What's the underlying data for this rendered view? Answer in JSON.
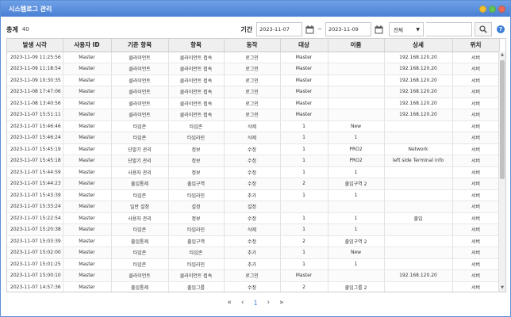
{
  "window": {
    "title": "시스템로그 관리"
  },
  "toolbar": {
    "total_label": "총계",
    "total_count": "40",
    "period_label": "기간",
    "date_from": "2023-11-07",
    "date_to": "2023-11-09",
    "tilde": "~",
    "filter_selected": "전체",
    "search_value": "",
    "help_glyph": "?"
  },
  "table": {
    "columns": [
      "발생 시각",
      "사용자 ID",
      "기준 항목",
      "항목",
      "동작",
      "대상",
      "이름",
      "상세",
      "위치"
    ],
    "rows": [
      [
        "2023-11-09 11:25:56",
        "Master",
        "클라이언트",
        "클라이언트 접속",
        "로그인",
        "Master",
        "",
        "192.168.120.20",
        "서버"
      ],
      [
        "2023-11-09 11:18:54",
        "Master",
        "클라이언트",
        "클라이언트 접속",
        "로그인",
        "Master",
        "",
        "192.168.120.20",
        "서버"
      ],
      [
        "2023-11-09 10:30:35",
        "Master",
        "클라이언트",
        "클라이언트 접속",
        "로그인",
        "Master",
        "",
        "192.168.120.20",
        "서버"
      ],
      [
        "2023-11-08 17:47:06",
        "Master",
        "클라이언트",
        "클라이언트 접속",
        "로그인",
        "Master",
        "",
        "192.168.120.20",
        "서버"
      ],
      [
        "2023-11-08 13:40:56",
        "Master",
        "클라이언트",
        "클라이언트 접속",
        "로그인",
        "Master",
        "",
        "192.168.120.20",
        "서버"
      ],
      [
        "2023-11-07 15:51:11",
        "Master",
        "클라이언트",
        "클라이언트 접속",
        "로그인",
        "Master",
        "",
        "192.168.120.20",
        "서버"
      ],
      [
        "2023-11-07 15:46:46",
        "Master",
        "타임존",
        "타임존",
        "삭제",
        "1",
        "New",
        "",
        "서버"
      ],
      [
        "2023-11-07 15:46:24",
        "Master",
        "타임존",
        "타임라인",
        "삭제",
        "1",
        "1",
        "",
        "서버"
      ],
      [
        "2023-11-07 15:45:19",
        "Master",
        "단말기 관리",
        "정보",
        "수정",
        "1",
        "PRO2",
        "Network",
        "서버"
      ],
      [
        "2023-11-07 15:45:18",
        "Master",
        "단말기 관리",
        "정보",
        "수정",
        "1",
        "PRO2",
        "left side Terminal info",
        "서버"
      ],
      [
        "2023-11-07 15:44:59",
        "Master",
        "사용자 관리",
        "정보",
        "수정",
        "1",
        "1",
        "",
        "서버"
      ],
      [
        "2023-11-07 15:44:23",
        "Master",
        "출입통제",
        "출입구역",
        "수정",
        "2",
        "출입구역 2",
        "",
        "서버"
      ],
      [
        "2023-11-07 15:43:39",
        "Master",
        "타임존",
        "타임라인",
        "추가",
        "1",
        "1",
        "",
        "서버"
      ],
      [
        "2023-11-07 15:33:24",
        "Master",
        "일반 설정",
        "설정",
        "설정",
        "",
        "",
        "",
        "서버"
      ],
      [
        "2023-11-07 15:22:54",
        "Master",
        "사용자 관리",
        "정보",
        "수정",
        "1",
        "1",
        "출입",
        "서버"
      ],
      [
        "2023-11-07 15:20:38",
        "Master",
        "타임존",
        "타임라인",
        "삭제",
        "1",
        "1",
        "",
        "서버"
      ],
      [
        "2023-11-07 15:03:39",
        "Master",
        "출입통제",
        "출입구역",
        "수정",
        "2",
        "출입구역 2",
        "",
        "서버"
      ],
      [
        "2023-11-07 15:02:00",
        "Master",
        "타임존",
        "타임존",
        "추가",
        "1",
        "New",
        "",
        "서버"
      ],
      [
        "2023-11-07 15:01:25",
        "Master",
        "타임존",
        "타임라인",
        "추가",
        "1",
        "1",
        "",
        "서버"
      ],
      [
        "2023-11-07 15:00:10",
        "Master",
        "클라이언트",
        "클라이언트 접속",
        "로그인",
        "Master",
        "",
        "192.168.120.20",
        "서버"
      ],
      [
        "2023-11-07 14:57:36",
        "Master",
        "출입통제",
        "출입그룹",
        "수정",
        "2",
        "출입그룹 2",
        "",
        "서버"
      ]
    ]
  },
  "pager": {
    "first": "«",
    "prev": "‹",
    "current": "1",
    "next": "›",
    "last": "»"
  },
  "colors": {
    "accent": "#3c7fd9",
    "title_bar": "#5b8fd6",
    "min": "#f2c12e",
    "max": "#62c554",
    "close": "#ea6a5a"
  }
}
